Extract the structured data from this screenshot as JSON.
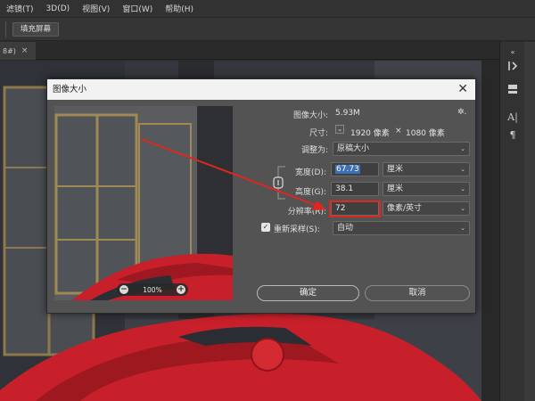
{
  "menubar": {
    "items": [
      "滤镜(T)",
      "3D(D)",
      "视图(V)",
      "窗口(W)",
      "帮助(H)"
    ]
  },
  "options_bar": {
    "fill_screen_label": "填充屏幕"
  },
  "document_tab": {
    "label": "8#)",
    "close": "×"
  },
  "dialog": {
    "title": "图像大小",
    "close": "✕",
    "image_size_label": "图像大小:",
    "image_size_value": "5.93M",
    "dimensions_label": "尺寸:",
    "dimensions_width": "1920 像素",
    "dimensions_times": "×",
    "dimensions_height": "1080 像素",
    "fit_to_label": "调整为:",
    "fit_to_value": "原稿大小",
    "width_label": "宽度(D):",
    "width_value": "67.73",
    "width_unit": "厘米",
    "height_label": "高度(G):",
    "height_value": "38.1",
    "height_unit": "厘米",
    "resolution_label": "分辨率(R):",
    "resolution_value": "72",
    "resolution_unit": "像素/英寸",
    "resample_label": "重新采样(S):",
    "resample_checked": true,
    "resample_value": "自动",
    "preview_zoom": "100%",
    "zoom_out": "−",
    "zoom_in": "+",
    "ok_label": "确定",
    "cancel_label": "取消"
  },
  "colors": {
    "annotation_red": "#e0261e",
    "car_red": "#c8202a",
    "selection_blue": "#3b6fb6"
  }
}
